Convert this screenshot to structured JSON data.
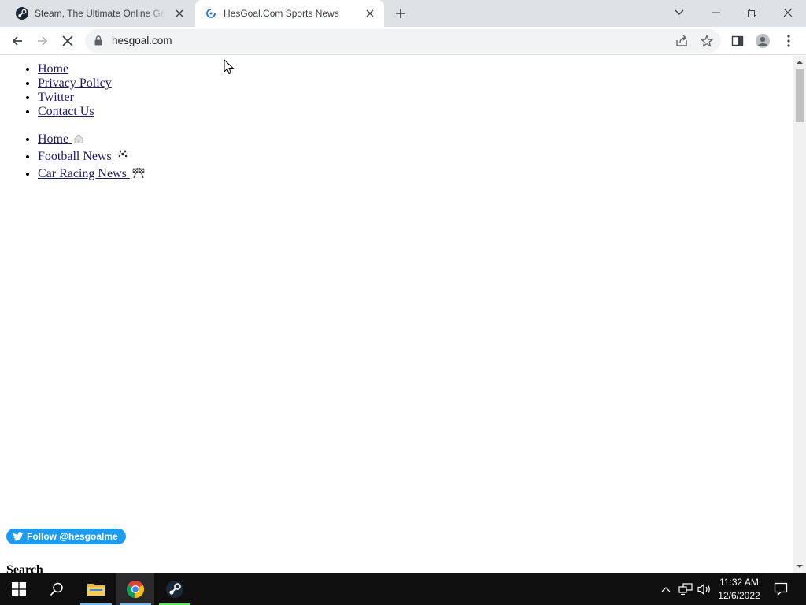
{
  "browser": {
    "tabs": [
      {
        "title": "Steam, The Ultimate Online Game Platform",
        "active": false
      },
      {
        "title": "HesGoal.Com Sports News",
        "active": true
      }
    ],
    "url": "hesgoal.com"
  },
  "page": {
    "top_menu": [
      "Home",
      "Privacy Policy",
      "Twitter",
      "Contact Us"
    ],
    "main_menu": [
      {
        "label": "Home ",
        "icon": "house-icon"
      },
      {
        "label": "Football News ",
        "icon": "soccer-ball-icon"
      },
      {
        "label": "Car Racing News ",
        "icon": "racing-flags-icon"
      }
    ],
    "follow_button": "Follow @hesgoalme",
    "search_heading": "Search"
  },
  "taskbar": {
    "time": "11:32 AM",
    "date": "12/6/2022",
    "apps": [
      "start-icon",
      "search-icon",
      "file-explorer-icon",
      "chrome-icon",
      "steam-icon"
    ]
  },
  "colors": {
    "tabstrip": "#dee1e6",
    "link": "#1f1a5e",
    "twitter_blue": "#1d9bf0",
    "taskbar": "#0f0f10"
  }
}
